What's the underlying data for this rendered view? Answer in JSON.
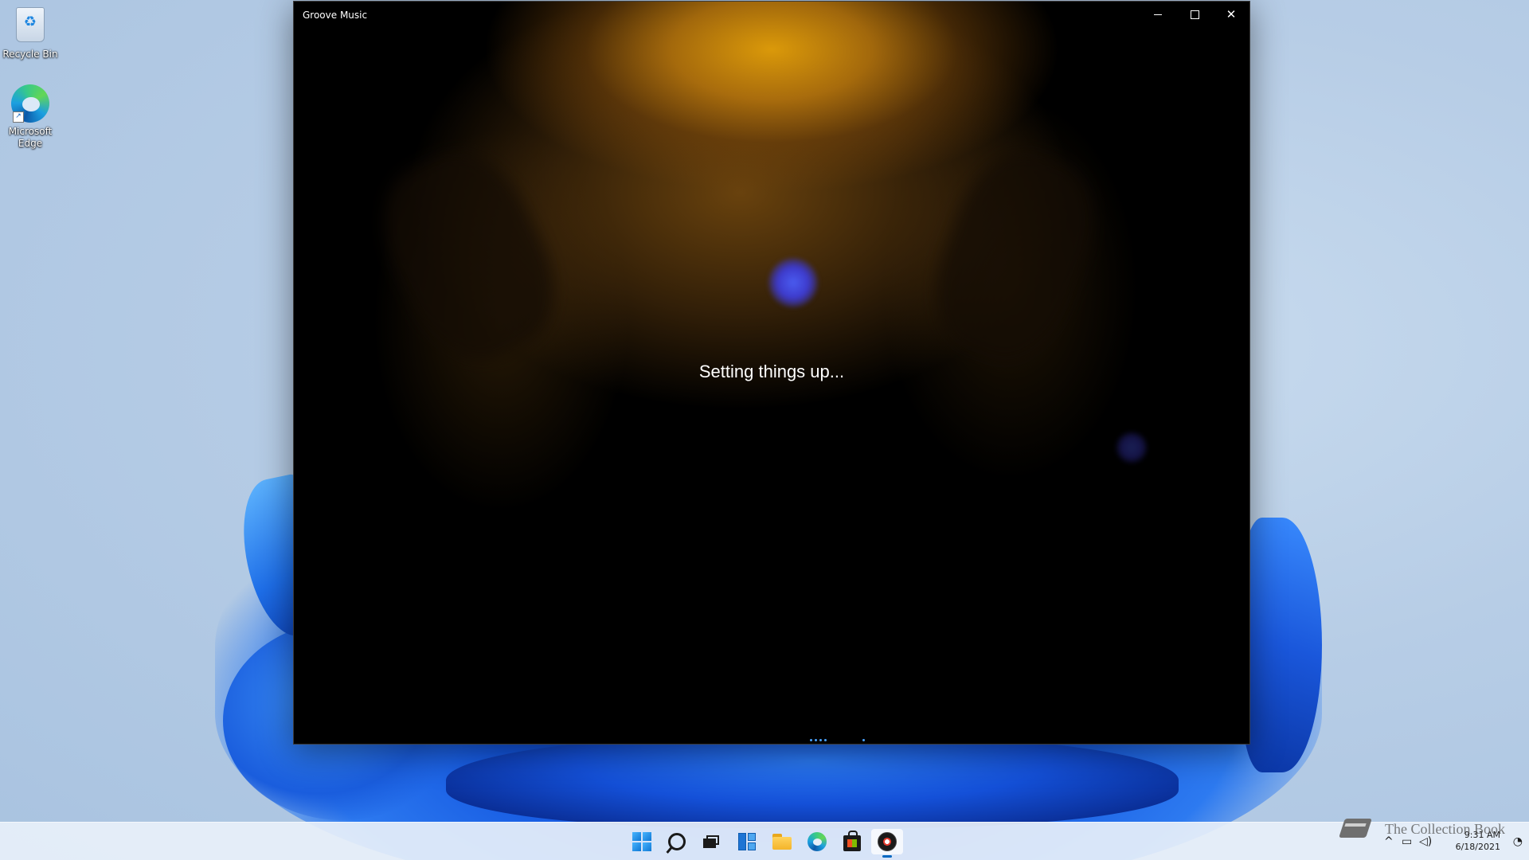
{
  "desktop": {
    "icons": [
      {
        "label": "Recycle Bin",
        "icon": "recycle-bin-icon"
      },
      {
        "label": "Microsoft Edge",
        "icon": "edge-icon"
      }
    ]
  },
  "window": {
    "title": "Groove Music",
    "minimize_icon": "minimize-icon",
    "maximize_icon": "maximize-icon",
    "close_icon": "close-icon",
    "close_glyph": "✕",
    "status": "Setting things up...",
    "accent_color": "#4aa3ff"
  },
  "taskbar": {
    "apps": [
      {
        "name": "Start",
        "icon": "windows-start-icon"
      },
      {
        "name": "Search",
        "icon": "search-icon"
      },
      {
        "name": "Task View",
        "icon": "task-view-icon"
      },
      {
        "name": "Widgets",
        "icon": "widgets-icon"
      },
      {
        "name": "File Explorer",
        "icon": "file-explorer-icon"
      },
      {
        "name": "Microsoft Edge",
        "icon": "edge-icon"
      },
      {
        "name": "Microsoft Store",
        "icon": "store-icon"
      },
      {
        "name": "Groove Music",
        "icon": "groove-music-icon",
        "active": true
      }
    ],
    "tray": {
      "chevron": "^",
      "clock_time": "9:31 AM",
      "clock_date": "6/18/2021"
    }
  },
  "watermark": {
    "text": "The Collection Book"
  }
}
